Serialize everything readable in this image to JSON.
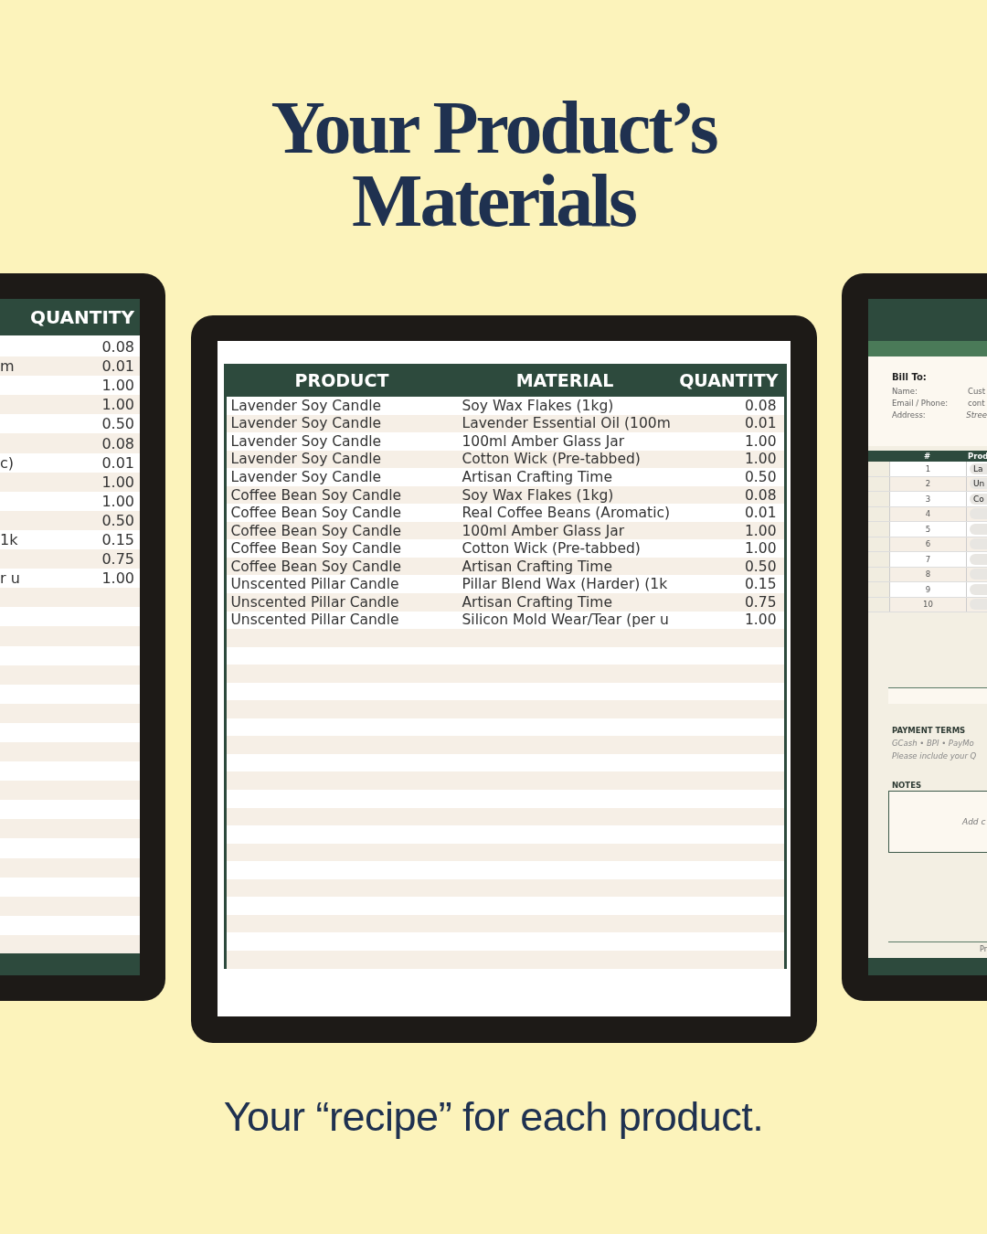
{
  "headline": [
    "Your Product’s",
    "Materials"
  ],
  "left_sheet": {
    "columns": [
      "QUANTITY"
    ],
    "rows": [
      {
        "quantity": "0.08"
      },
      {
        "material_fragment": "m",
        "quantity": "0.01"
      },
      {
        "quantity": "1.00"
      },
      {
        "quantity": "1.00"
      },
      {
        "quantity": "0.50"
      },
      {
        "quantity": "0.08"
      },
      {
        "material_fragment": "c)",
        "quantity": "0.01"
      },
      {
        "quantity": "1.00"
      },
      {
        "quantity": "1.00"
      },
      {
        "quantity": "0.50"
      },
      {
        "material_fragment": "1k",
        "quantity": "0.15"
      },
      {
        "quantity": "0.75"
      },
      {
        "material_fragment": "r u",
        "quantity": "1.00"
      }
    ]
  },
  "center_sheet": {
    "columns": [
      "PRODUCT",
      "MATERIAL",
      "QUANTITY"
    ],
    "rows": [
      {
        "product": "Lavender Soy Candle",
        "material": "Soy Wax Flakes (1kg)",
        "quantity": "0.08"
      },
      {
        "product": "Lavender Soy Candle",
        "material": "Lavender Essential Oil (100m",
        "quantity": "0.01"
      },
      {
        "product": "Lavender Soy Candle",
        "material": "100ml Amber Glass Jar",
        "quantity": "1.00"
      },
      {
        "product": "Lavender Soy Candle",
        "material": "Cotton Wick (Pre-tabbed)",
        "quantity": "1.00"
      },
      {
        "product": "Lavender Soy Candle",
        "material": "Artisan Crafting Time",
        "quantity": "0.50"
      },
      {
        "product": "Coffee Bean Soy Candle",
        "material": "Soy Wax Flakes (1kg)",
        "quantity": "0.08"
      },
      {
        "product": "Coffee Bean Soy Candle",
        "material": "Real Coffee Beans (Aromatic)",
        "quantity": "0.01"
      },
      {
        "product": "Coffee Bean Soy Candle",
        "material": "100ml Amber Glass Jar",
        "quantity": "1.00"
      },
      {
        "product": "Coffee Bean Soy Candle",
        "material": "Cotton Wick (Pre-tabbed)",
        "quantity": "1.00"
      },
      {
        "product": "Coffee Bean Soy Candle",
        "material": "Artisan Crafting Time",
        "quantity": "0.50"
      },
      {
        "product": "Unscented Pillar Candle",
        "material": "Pillar Blend Wax (Harder) (1k",
        "quantity": "0.15"
      },
      {
        "product": "Unscented Pillar Candle",
        "material": "Artisan Crafting Time",
        "quantity": "0.75"
      },
      {
        "product": "Unscented Pillar Candle",
        "material": "Silicon Mold Wear/Tear (per u",
        "quantity": "1.00"
      }
    ]
  },
  "right_sheet": {
    "bill_to": {
      "title": "Bill To:",
      "fields": [
        {
          "label": "Name:",
          "value": "Cust"
        },
        {
          "label": "Email / Phone:",
          "value": "cont"
        },
        {
          "label": "Address:",
          "value": "Stree"
        }
      ]
    },
    "table": {
      "columns": [
        "#",
        "Prod"
      ],
      "rows": [
        {
          "number": "1",
          "product": "La"
        },
        {
          "number": "2",
          "product": "Un"
        },
        {
          "number": "3",
          "product": "Co"
        },
        {
          "number": "4"
        },
        {
          "number": "5"
        },
        {
          "number": "6"
        },
        {
          "number": "7"
        },
        {
          "number": "8"
        },
        {
          "number": "9"
        },
        {
          "number": "10"
        }
      ]
    },
    "payment_terms": {
      "title": "PAYMENT TERMS",
      "lines": [
        "GCash • BPI • PayMo",
        "Please include your Q"
      ]
    },
    "notes": {
      "title": "NOTES",
      "placeholder": "Add c"
    },
    "footer": "Pr"
  },
  "caption": "Your “recipe” for each product."
}
